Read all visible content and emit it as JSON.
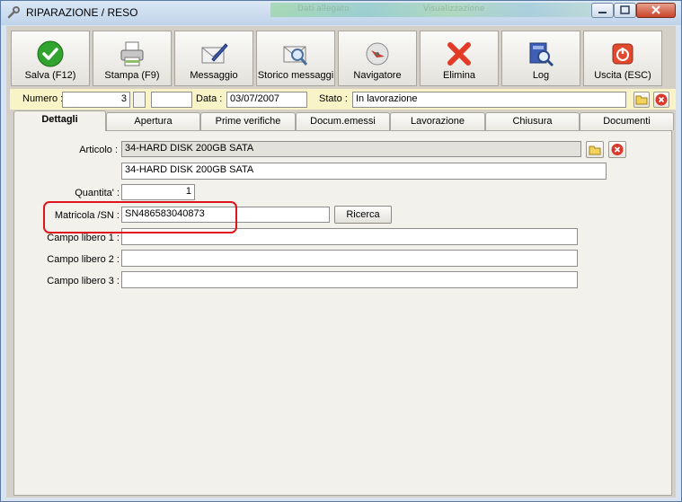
{
  "window": {
    "title": "RIPARAZIONE / RESO",
    "blurred_texts": [
      "Dati allegato",
      "Visualizzazione"
    ]
  },
  "toolbar": {
    "buttons": [
      {
        "label": "Salva (F12)",
        "icon": "check-icon"
      },
      {
        "label": "Stampa (F9)",
        "icon": "printer-icon"
      },
      {
        "label": "Messaggio",
        "icon": "envelope-pen-icon"
      },
      {
        "label": "Storico messaggi",
        "icon": "envelope-search-icon"
      },
      {
        "label": "Navigatore",
        "icon": "navigator-icon"
      },
      {
        "label": "Elimina",
        "icon": "delete-x-icon"
      },
      {
        "label": "Log",
        "icon": "book-search-icon"
      },
      {
        "label": "Uscita (ESC)",
        "icon": "power-icon"
      }
    ]
  },
  "infobar": {
    "numero_label": "Numero :",
    "numero_value": "3",
    "data_label": "Data :",
    "data_value": "03/07/2007",
    "stato_label": "Stato :",
    "stato_value": "In lavorazione"
  },
  "tabs": [
    "Dettagli",
    "Apertura",
    "Prime verifiche",
    "Docum.emessi",
    "Lavorazione",
    "Chiusura",
    "Documenti"
  ],
  "details": {
    "articolo_label": "Articolo :",
    "articolo_value": "34-HARD DISK 200GB SATA",
    "articolo_desc": "34-HARD DISK 200GB SATA",
    "quantita_label": "Quantita' :",
    "quantita_value": "1",
    "matricola_label": "Matricola /SN :",
    "matricola_value": "SN486583040873",
    "ricerca_label": "Ricerca",
    "campo1_label": "Campo libero 1 :",
    "campo1_value": "",
    "campo2_label": "Campo libero 2 :",
    "campo2_value": "",
    "campo3_label": "Campo libero 3 :",
    "campo3_value": ""
  },
  "colors": {
    "infobar_bg": "#f9f4c8",
    "highlight": "#e0141b",
    "panel_bg": "#f2f1ec"
  }
}
